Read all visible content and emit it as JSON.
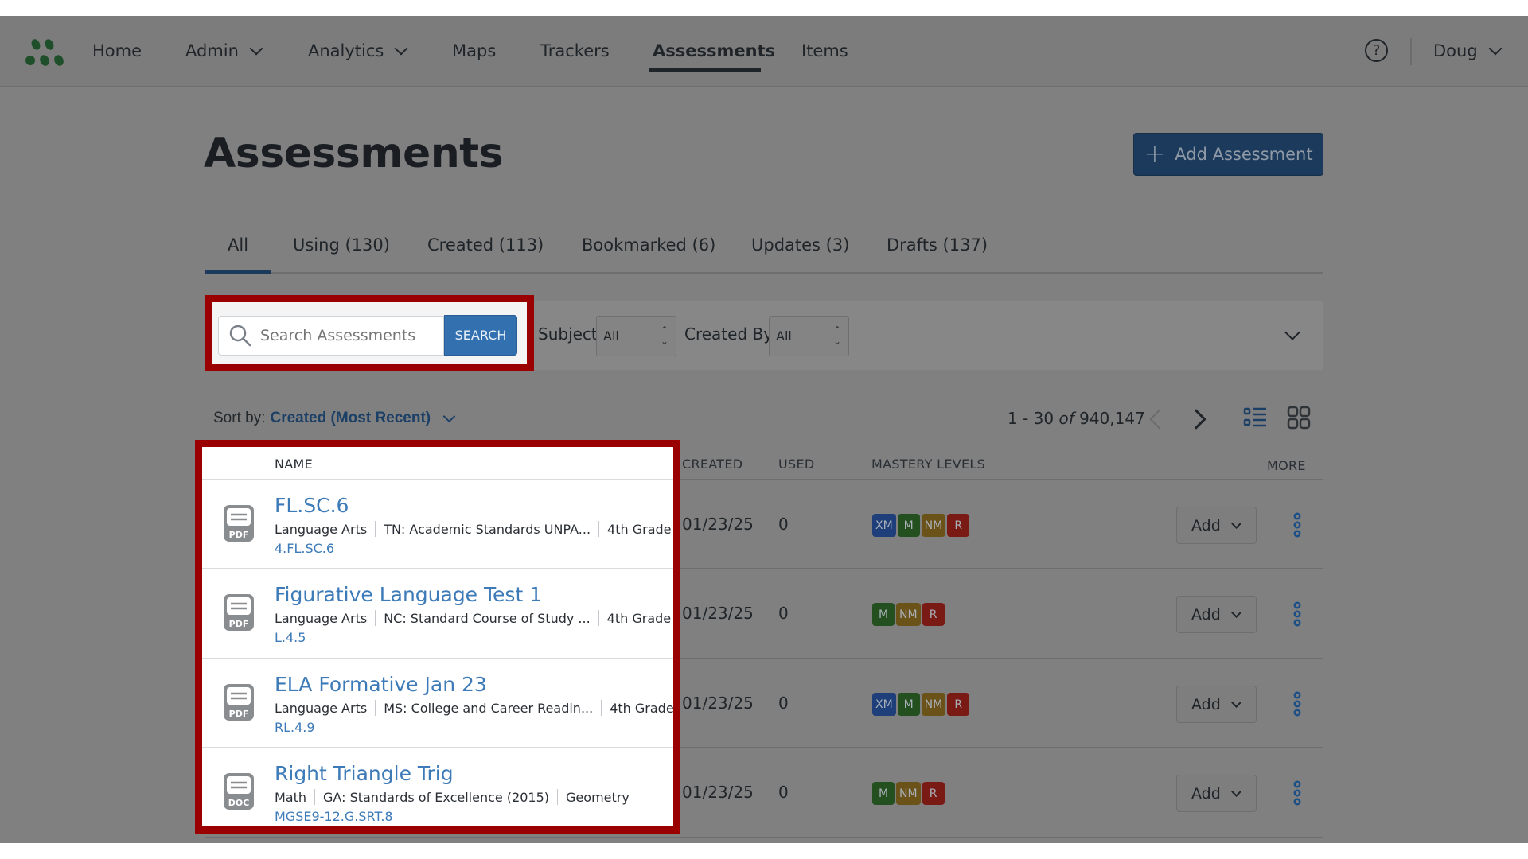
{
  "nav": {
    "items": [
      {
        "label": "Home",
        "has_dropdown": false
      },
      {
        "label": "Admin",
        "has_dropdown": true
      },
      {
        "label": "Analytics",
        "has_dropdown": true
      },
      {
        "label": "Maps",
        "has_dropdown": false
      },
      {
        "label": "Trackers",
        "has_dropdown": false
      },
      {
        "label": "Assessments",
        "has_dropdown": false,
        "active": true
      },
      {
        "label": "Items",
        "has_dropdown": false
      }
    ],
    "help_icon": "question-circle-icon",
    "user_name": "Doug"
  },
  "page": {
    "title": "Assessments",
    "add_button_label": "Add Assessment"
  },
  "tabs": [
    {
      "label": "All",
      "active": true
    },
    {
      "label": "Using (130)"
    },
    {
      "label": "Created (113)"
    },
    {
      "label": "Bookmarked (6)"
    },
    {
      "label": "Updates (3)"
    },
    {
      "label": "Drafts (137)"
    }
  ],
  "filters": {
    "search_placeholder": "Search Assessments",
    "search_value": "",
    "search_button_label": "SEARCH",
    "subject_label": "Subject",
    "subject_value": "All",
    "created_by_label": "Created By",
    "created_by_value": "All"
  },
  "sort": {
    "label": "Sort by:",
    "value": "Created (Most Recent)"
  },
  "pagination": {
    "range": "1 - 30",
    "of_label": "of",
    "total": "940,147"
  },
  "table": {
    "headers": {
      "name": "NAME",
      "created": "CREATED",
      "used": "USED",
      "mastery": "MASTERY LEVELS",
      "more": "MORE"
    },
    "add_label": "Add",
    "rows": [
      {
        "file_type": "PDF",
        "title": "FL.SC.6",
        "subject": "Language Arts",
        "standard_set": "TN: Academic Standards UNPA...",
        "grade": "4th Grade",
        "standard": "4.FL.SC.6",
        "created": "01/23/25",
        "used": "0",
        "mastery": [
          "XM",
          "M",
          "NM",
          "R"
        ]
      },
      {
        "file_type": "PDF",
        "title": "Figurative Language Test 1",
        "subject": "Language Arts",
        "standard_set": "NC: Standard Course of Study ...",
        "grade": "4th Grade",
        "standard": "L.4.5",
        "created": "01/23/25",
        "used": "0",
        "mastery": [
          "M",
          "NM",
          "R"
        ]
      },
      {
        "file_type": "PDF",
        "title": "ELA Formative Jan 23",
        "subject": "Language Arts",
        "standard_set": "MS: College and Career Readin...",
        "grade": "4th Grade",
        "standard": "RL.4.9",
        "created": "01/23/25",
        "used": "0",
        "mastery": [
          "XM",
          "M",
          "NM",
          "R"
        ]
      },
      {
        "file_type": "DOC",
        "title": "Right Triangle Trig",
        "subject": "Math",
        "standard_set": "GA: Standards of Excellence (2015)",
        "grade": "Geometry",
        "standard": "MGSE9-12.G.SRT.8",
        "created": "01/23/25",
        "used": "0",
        "mastery": [
          "M",
          "NM",
          "R"
        ]
      }
    ]
  },
  "colors": {
    "mastery": {
      "XM": "#1f3f7a",
      "M": "#24501f",
      "NM": "#6b5219",
      "R": "#7a1a14"
    },
    "highlight_border": "#9b0000",
    "link": "#3d7ab8",
    "primary_button": "#3370b0"
  }
}
